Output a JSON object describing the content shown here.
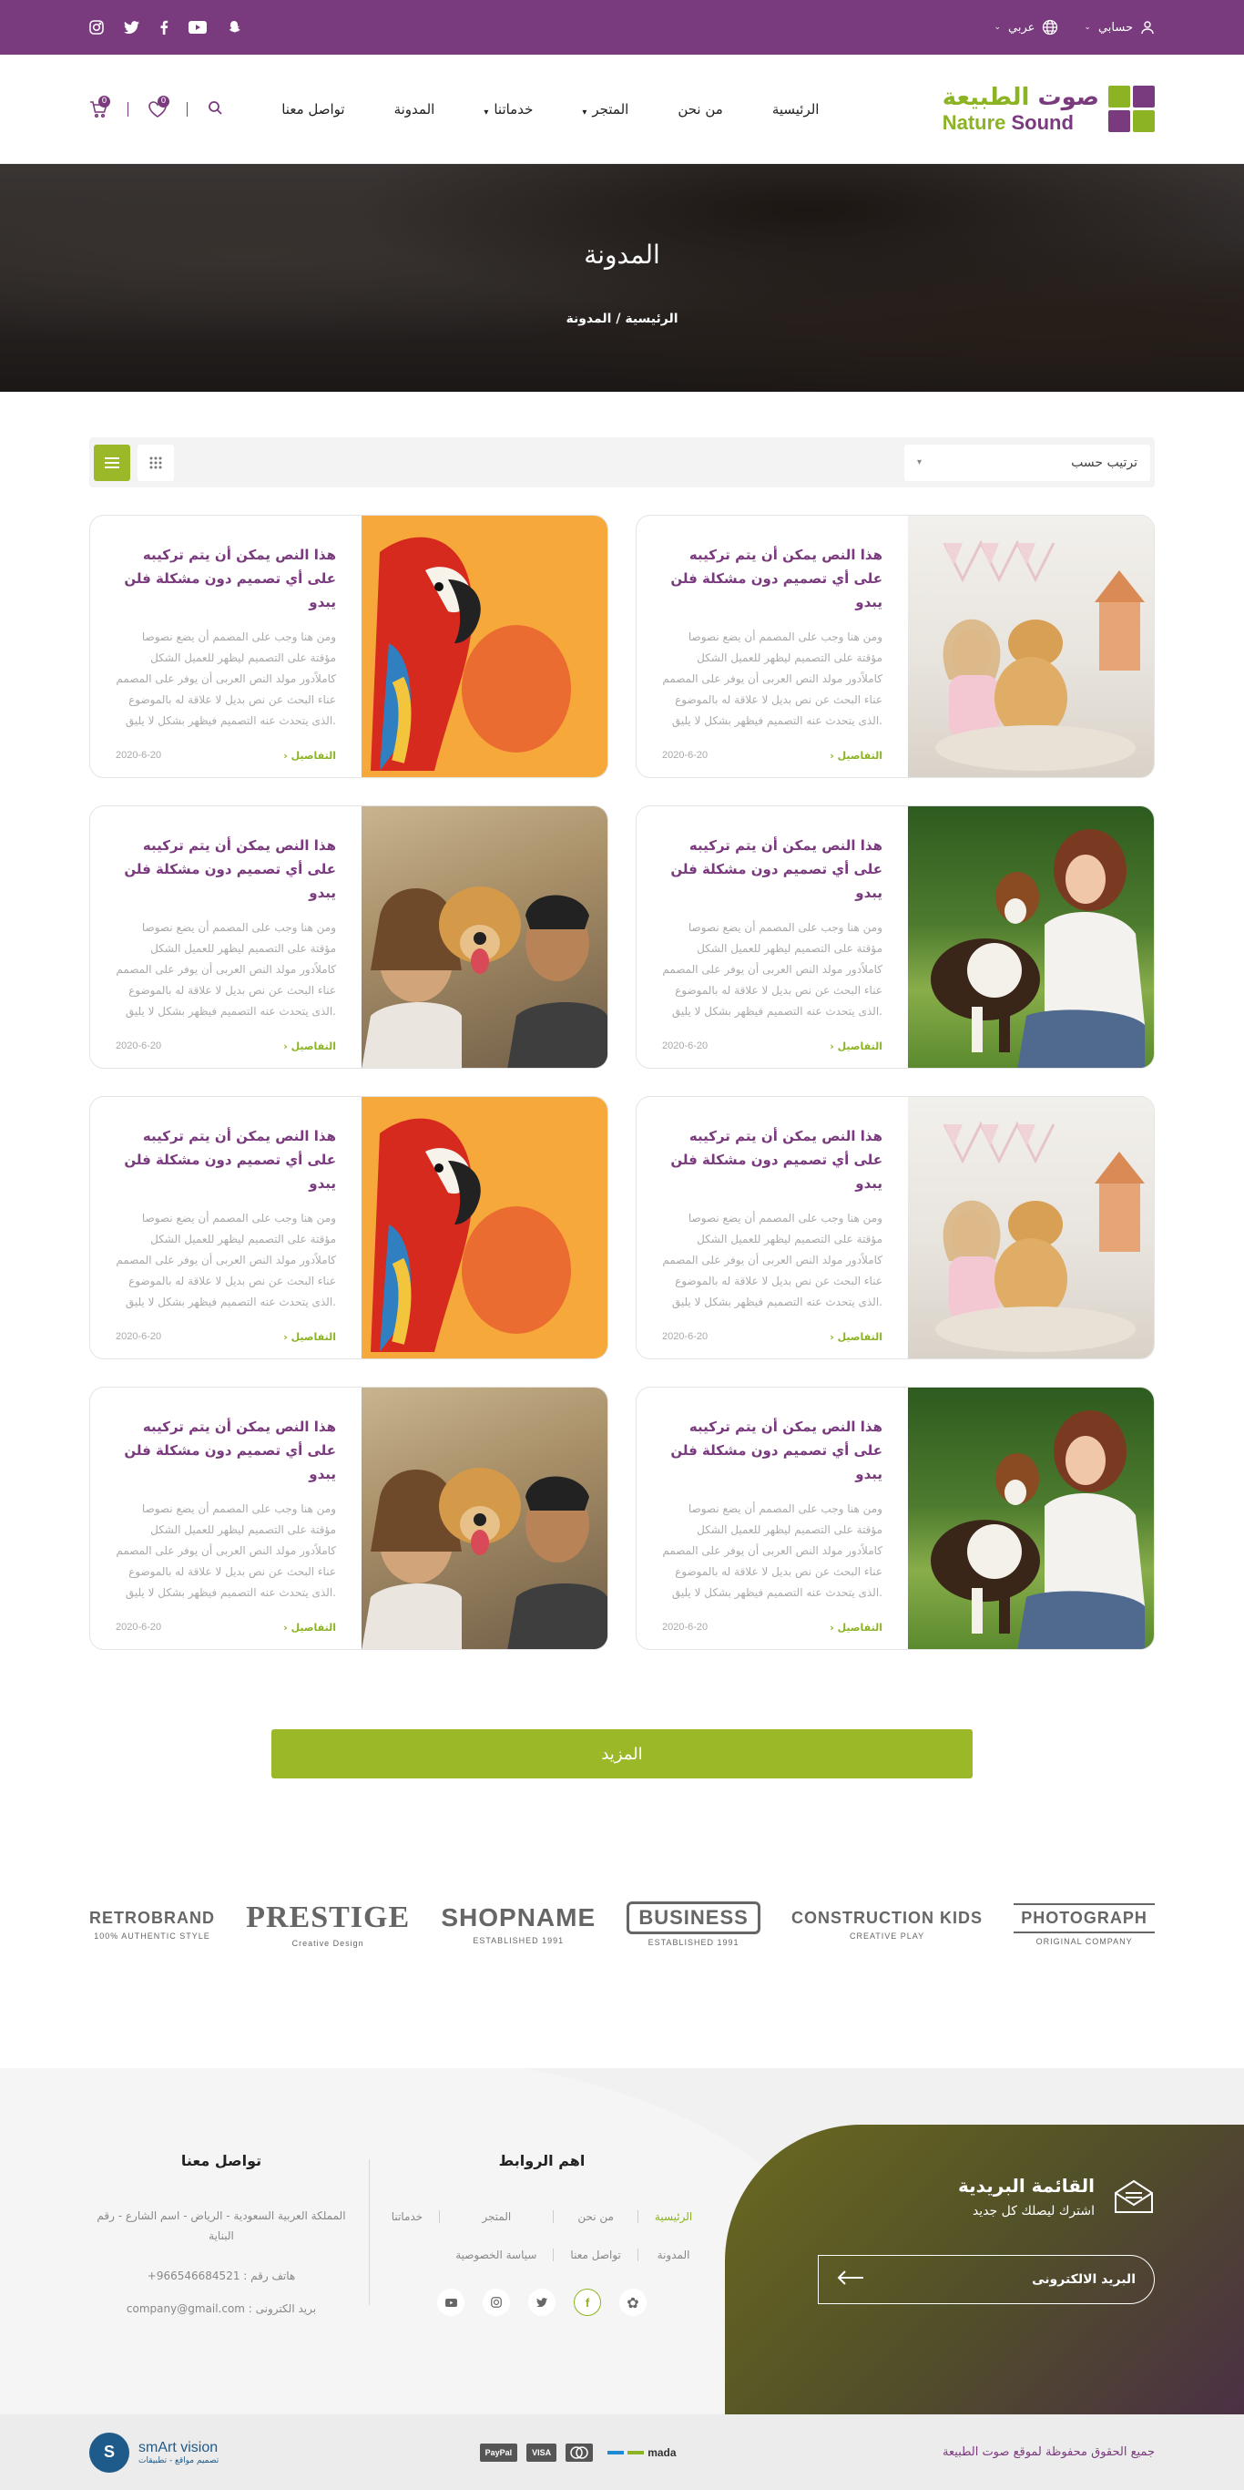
{
  "topbar": {
    "account_label": "حسابي",
    "language_label": "عربي",
    "social_icons": [
      "snapchat-icon",
      "youtube-icon",
      "facebook-icon",
      "twitter-icon",
      "instagram-icon"
    ]
  },
  "header": {
    "logo_ar": "صوت الطبيعة",
    "logo_ar_part1": "صوت",
    "logo_ar_part2": " الطبيعة",
    "logo_en_part1": "Nature",
    "logo_en_part2": " Sound",
    "nav": [
      "الرئيسية",
      "من نحن",
      "المتجر",
      "خدماتنا",
      "المدونة",
      "تواصل معنا"
    ],
    "wishlist_count": "0",
    "cart_count": "0"
  },
  "hero": {
    "title": "المدونة",
    "breadcrumb": "الرئيسية / المدونة"
  },
  "toolbar": {
    "sort_label": "ترتيب حسب"
  },
  "cards": [
    {
      "title": "هذا النص يمكن أن يتم تركيبه على أي تصميم دون مشكلة فلن يبدو",
      "excerpt": "ومن هنا وجب على المصمم أن يضع نصوصا مؤقتة على التصميم ليظهر للعميل الشكل كاملاًدور مولد النص العربى أن يوفر على المصمم عناء البحث عن نص بديل لا علاقة له بالموضوع .الذى يتحدث عنه التصميم فيظهر بشكل لا يليق",
      "more": "التفاصيل",
      "date": "2020-6-20",
      "image": "dog-girl"
    },
    {
      "title": "هذا النص يمكن أن يتم تركيبه على أي تصميم دون مشكلة فلن يبدو",
      "excerpt": "ومن هنا وجب على المصمم أن يضع نصوصا مؤقتة على التصميم ليظهر للعميل الشكل كاملاًدور مولد النص العربى أن يوفر على المصمم عناء البحث عن نص بديل لا علاقة له بالموضوع .الذى يتحدث عنه التصميم فيظهر بشكل لا يليق",
      "more": "التفاصيل",
      "date": "2020-6-20",
      "image": "parrot"
    },
    {
      "title": "هذا النص يمكن أن يتم تركيبه على أي تصميم دون مشكلة فلن يبدو",
      "excerpt": "ومن هنا وجب على المصمم أن يضع نصوصا مؤقتة على التصميم ليظهر للعميل الشكل كاملاًدور مولد النص العربى أن يوفر على المصمم عناء البحث عن نص بديل لا علاقة له بالموضوع .الذى يتحدث عنه التصميم فيظهر بشكل لا يليق",
      "more": "التفاصيل",
      "date": "2020-6-20",
      "image": "woman-dog"
    },
    {
      "title": "هذا النص يمكن أن يتم تركيبه على أي تصميم دون مشكلة فلن يبدو",
      "excerpt": "ومن هنا وجب على المصمم أن يضع نصوصا مؤقتة على التصميم ليظهر للعميل الشكل كاملاًدور مولد النص العربى أن يوفر على المصمم عناء البحث عن نص بديل لا علاقة له بالموضوع .الذى يتحدث عنه التصميم فيظهر بشكل لا يليق",
      "more": "التفاصيل",
      "date": "2020-6-20",
      "image": "couple"
    },
    {
      "title": "هذا النص يمكن أن يتم تركيبه على أي تصميم دون مشكلة فلن يبدو",
      "excerpt": "ومن هنا وجب على المصمم أن يضع نصوصا مؤقتة على التصميم ليظهر للعميل الشكل كاملاًدور مولد النص العربى أن يوفر على المصمم عناء البحث عن نص بديل لا علاقة له بالموضوع .الذى يتحدث عنه التصميم فيظهر بشكل لا يليق",
      "more": "التفاصيل",
      "date": "2020-6-20",
      "image": "dog-girl"
    },
    {
      "title": "هذا النص يمكن أن يتم تركيبه على أي تصميم دون مشكلة فلن يبدو",
      "excerpt": "ومن هنا وجب على المصمم أن يضع نصوصا مؤقتة على التصميم ليظهر للعميل الشكل كاملاًدور مولد النص العربى أن يوفر على المصمم عناء البحث عن نص بديل لا علاقة له بالموضوع .الذى يتحدث عنه التصميم فيظهر بشكل لا يليق",
      "more": "التفاصيل",
      "date": "2020-6-20",
      "image": "parrot"
    },
    {
      "title": "هذا النص يمكن أن يتم تركيبه على أي تصميم دون مشكلة فلن يبدو",
      "excerpt": "ومن هنا وجب على المصمم أن يضع نصوصا مؤقتة على التصميم ليظهر للعميل الشكل كاملاًدور مولد النص العربى أن يوفر على المصمم عناء البحث عن نص بديل لا علاقة له بالموضوع .الذى يتحدث عنه التصميم فيظهر بشكل لا يليق",
      "more": "التفاصيل",
      "date": "2020-6-20",
      "image": "woman-dog"
    },
    {
      "title": "هذا النص يمكن أن يتم تركيبه على أي تصميم دون مشكلة فلن يبدو",
      "excerpt": "ومن هنا وجب على المصمم أن يضع نصوصا مؤقتة على التصميم ليظهر للعميل الشكل كاملاًدور مولد النص العربى أن يوفر على المصمم عناء البحث عن نص بديل لا علاقة له بالموضوع .الذى يتحدث عنه التصميم فيظهر بشكل لا يليق",
      "more": "التفاصيل",
      "date": "2020-6-20",
      "image": "couple"
    }
  ],
  "more_button": "المزيد",
  "brands": [
    {
      "main": "RETROBRAND",
      "sub": "100% AUTHENTIC STYLE"
    },
    {
      "main": "PRESTIGE",
      "sub": "Creative Design"
    },
    {
      "main": "SHOPNAME",
      "sub": "ESTABLISHED 1991"
    },
    {
      "main": "BUSINESS",
      "sub": "ESTABLISHED 1991"
    },
    {
      "main": "CONSTRUCTION KIDS",
      "sub": "CREATIVE PLAY"
    },
    {
      "main": "PHOTOGRAPH",
      "sub": "ORIGINAL COMPANY"
    }
  ],
  "footer": {
    "newsletter_title": "القائمة البريدية",
    "newsletter_sub": "اشترك ليصلك كل جديد",
    "email_placeholder": "البريد الالكترونى",
    "links_title": "اهم الروابط",
    "links": [
      "الرئيسية",
      "من نحن",
      "المتجر",
      "خدماتنا",
      "المدونة",
      "تواصل معنا",
      "سياسة الخصوصية"
    ],
    "contact_title": "تواصل معنا",
    "address": "المملكة العربية السعودية - الرياض - اسم الشارع - رقم البناية",
    "phone": "هاتف رقم : 966546684521+",
    "email": "بريد الكترونى : company@gmail.com",
    "social_icons": [
      "snapchat-icon",
      "facebook-icon",
      "twitter-icon",
      "instagram-icon",
      "youtube-icon"
    ]
  },
  "bottom": {
    "copyright": "جميع الحقوق محفوظة لموقع صوت الطبيعة",
    "payments": [
      "PayPal",
      "VISA",
      "MasterCard",
      "mada"
    ],
    "credit_name": "smArt vision",
    "credit_sub": "تصميم مواقع - تطبيقات"
  },
  "colors": {
    "primary_purple": "#7a3a7e",
    "accent_green": "#9bb829"
  }
}
